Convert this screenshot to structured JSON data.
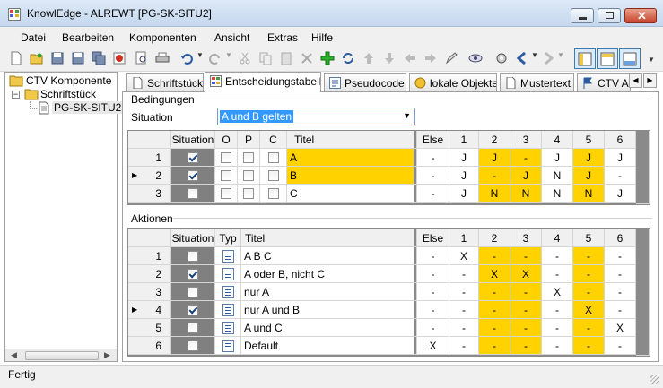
{
  "window": {
    "title": "KnowlEdge - ALREWT [PG-SK-SITU2]"
  },
  "menu": [
    "Datei",
    "Bearbeiten",
    "Komponenten",
    "Ansicht",
    "Extras",
    "Hilfe"
  ],
  "tree": {
    "root": "CTV Komponente",
    "child": "Schriftstück",
    "leaf": "PG-SK-SITU2"
  },
  "tabs": [
    "Schriftstück",
    "Entscheidungstabelle",
    "Pseudocode",
    "lokale Objekte",
    "Mustertext",
    "CTV A"
  ],
  "bedingungen": {
    "label": "Bedingungen",
    "situation_label": "Situation",
    "situation_value": "A und B gelten",
    "headers": {
      "situation": "Situation",
      "o": "O",
      "p": "P",
      "c": "C",
      "titel": "Titel",
      "else": "Else",
      "cols": [
        "1",
        "2",
        "3",
        "4",
        "5",
        "6"
      ]
    },
    "rows": [
      {
        "num": "1",
        "checked": true,
        "titel": "A",
        "else": "-",
        "vals": [
          "J",
          "J",
          "-",
          "J",
          "J",
          "J"
        ]
      },
      {
        "num": "2",
        "checked": true,
        "titel": "B",
        "else": "-",
        "vals": [
          "J",
          "-",
          "J",
          "N",
          "J",
          "-"
        ]
      },
      {
        "num": "3",
        "checked": false,
        "titel": "C",
        "else": "-",
        "vals": [
          "J",
          "N",
          "N",
          "N",
          "N",
          "J"
        ]
      }
    ]
  },
  "aktionen": {
    "label": "Aktionen",
    "headers": {
      "situation": "Situation",
      "typ": "Typ",
      "titel": "Titel",
      "else": "Else",
      "cols": [
        "1",
        "2",
        "3",
        "4",
        "5",
        "6"
      ]
    },
    "rows": [
      {
        "num": "1",
        "checked": false,
        "titel": "A B C",
        "else": "-",
        "vals": [
          "X",
          "-",
          "-",
          "-",
          "-",
          "-"
        ]
      },
      {
        "num": "2",
        "checked": true,
        "titel": "A oder B, nicht C",
        "else": "-",
        "vals": [
          "-",
          "X",
          "X",
          "-",
          "-",
          "-"
        ]
      },
      {
        "num": "3",
        "checked": false,
        "titel": "nur A",
        "else": "-",
        "vals": [
          "-",
          "-",
          "-",
          "X",
          "-",
          "-"
        ]
      },
      {
        "num": "4",
        "checked": true,
        "titel": "nur A und B",
        "else": "-",
        "vals": [
          "-",
          "-",
          "-",
          "-",
          "X",
          "-"
        ]
      },
      {
        "num": "5",
        "checked": false,
        "titel": "A und C",
        "else": "-",
        "vals": [
          "-",
          "-",
          "-",
          "-",
          "-",
          "X"
        ]
      },
      {
        "num": "6",
        "checked": false,
        "titel": "Default",
        "else": "X",
        "vals": [
          "-",
          "-",
          "-",
          "-",
          "-",
          "-"
        ]
      }
    ]
  },
  "status": "Fertig",
  "colors": {
    "highlight": "#ffd200",
    "gray": "#808080"
  }
}
